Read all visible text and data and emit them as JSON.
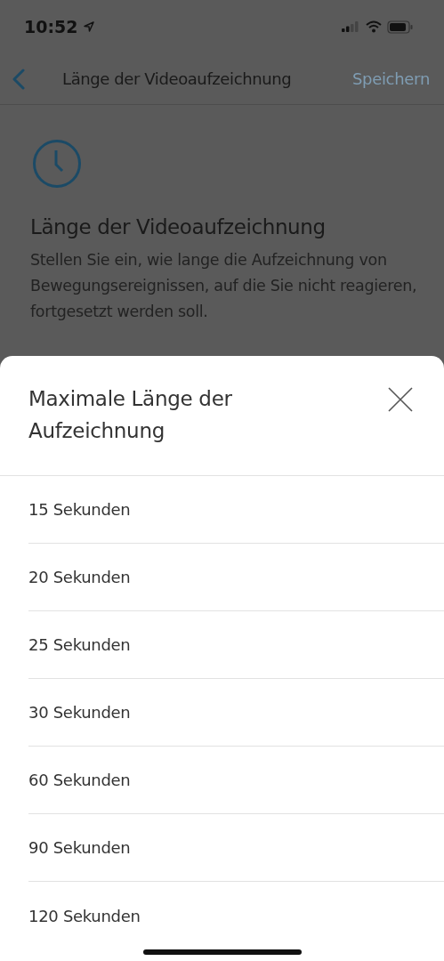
{
  "status_bar": {
    "time": "10:52"
  },
  "nav_bar": {
    "title": "Länge der Videoaufzeichnung",
    "save": "Speichern"
  },
  "content": {
    "heading": "Länge der Videoaufzeichnung",
    "description": "Stellen Sie ein, wie lange die Aufzeichnung von Bewegungsereignissen, auf die Sie nicht reagieren, fortgesetzt werden soll."
  },
  "sheet": {
    "title": "Maximale Länge der Aufzeichnung",
    "options": [
      {
        "label": "15 Sekunden"
      },
      {
        "label": "20 Sekunden"
      },
      {
        "label": "25 Sekunden"
      },
      {
        "label": "30 Sekunden"
      },
      {
        "label": "60 Sekunden"
      },
      {
        "label": "90 Sekunden"
      },
      {
        "label": "120 Sekunden"
      }
    ]
  }
}
